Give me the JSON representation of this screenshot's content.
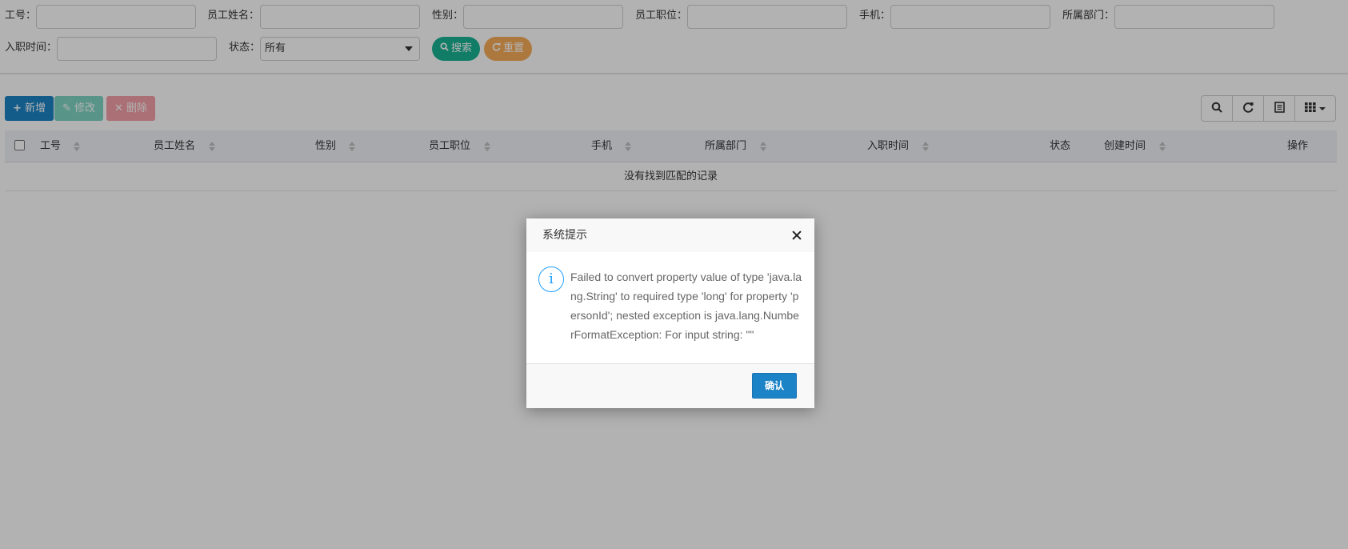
{
  "search": {
    "fields": [
      {
        "label": "工号："
      },
      {
        "label": "员工姓名："
      },
      {
        "label": "性别："
      },
      {
        "label": "员工职位："
      },
      {
        "label": "手机："
      },
      {
        "label": "所属部门："
      },
      {
        "label": "入职时间："
      },
      {
        "label": "状态："
      }
    ],
    "status_value": "所有",
    "search_label": "搜索",
    "reset_label": "重置"
  },
  "toolbar": {
    "add_label": "新增",
    "edit_label": "修改",
    "delete_label": "删除"
  },
  "table": {
    "columns": [
      "工号",
      "员工姓名",
      "性别",
      "员工职位",
      "手机",
      "所属部门",
      "入职时间",
      "状态",
      "创建时间",
      "操作"
    ],
    "empty_text": "没有找到匹配的记录"
  },
  "dialog": {
    "title": "系统提示",
    "message": "Failed to convert property value of type 'java.lang.String' to required type 'long' for property 'personId'; nested exception is java.lang.NumberFormatException: For input string: \"\"",
    "confirm_label": "确认"
  },
  "icons": {
    "search": "search-icon",
    "refresh": "refresh-icon",
    "plus": "plus-icon",
    "edit": "edit-icon",
    "delete": "close-icon",
    "export": "document-icon",
    "columns": "grid-icon",
    "info": "info-icon"
  },
  "colors": {
    "primary": "#1c84c6",
    "success": "#1ab394",
    "warning": "#f8ac59",
    "danger": "#ed5565",
    "info_icon": "#1e9fff"
  }
}
